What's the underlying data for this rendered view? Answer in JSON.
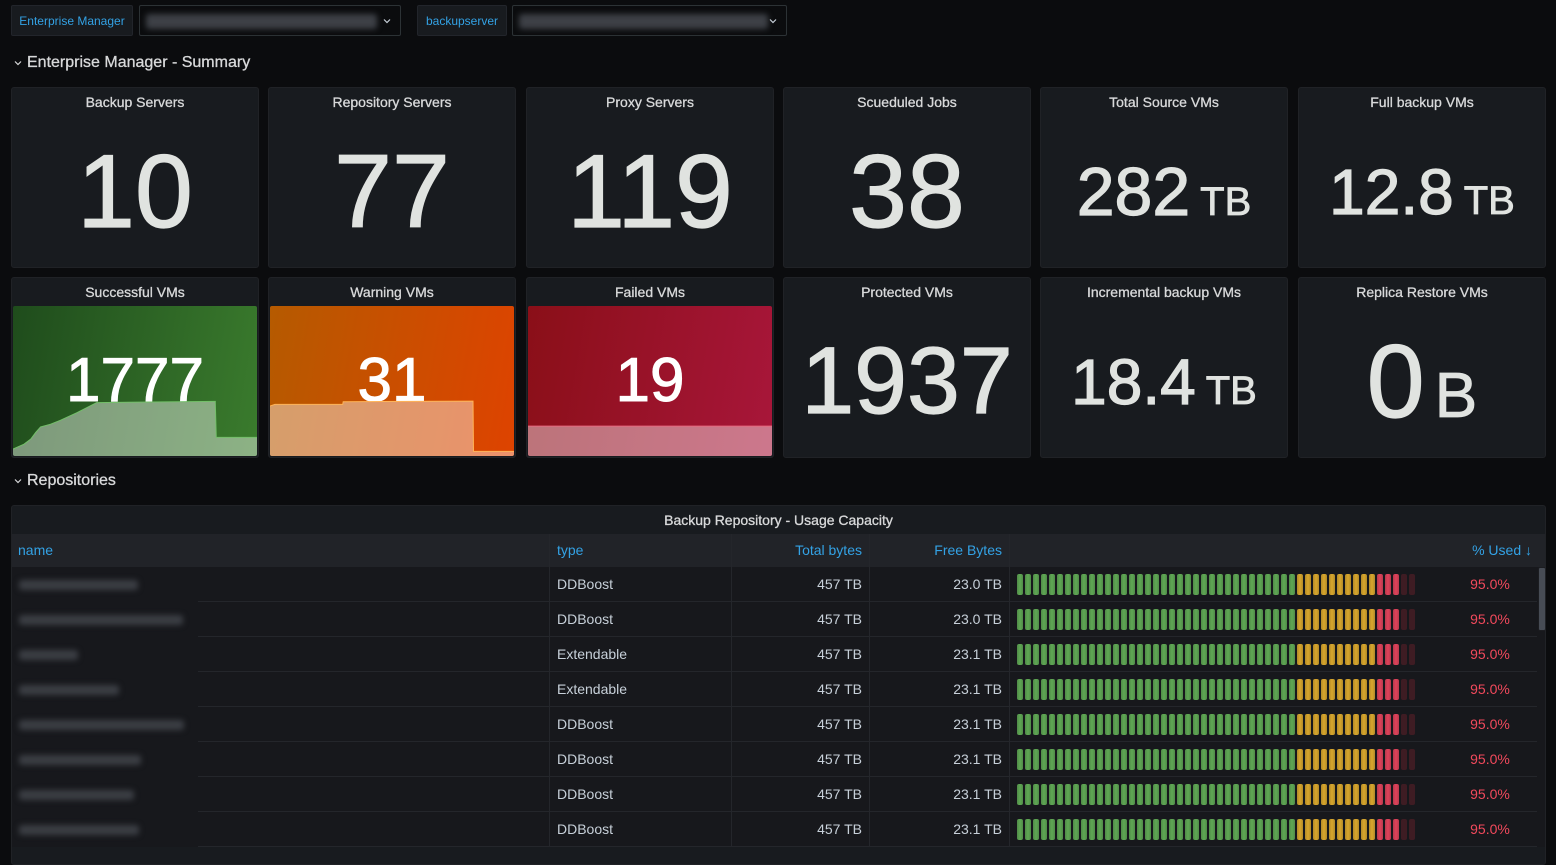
{
  "theme": {
    "page_bg": "#0b0c0e",
    "panel_bg": "#181b1f",
    "accent": "#33a2e5"
  },
  "variables": [
    {
      "label": "Enterprise Manager",
      "value": "",
      "value_redacted": true,
      "icon": "chevron-down-icon"
    },
    {
      "label": "backupserver",
      "value": "",
      "value_redacted": true,
      "icon": "chevron-down-icon"
    }
  ],
  "sections": {
    "summary": {
      "title": "Enterprise Manager - Summary",
      "expanded": true
    },
    "repositories": {
      "title": "Repositories",
      "expanded": true
    }
  },
  "stats": [
    {
      "title": "Backup Servers",
      "value": "10",
      "unit": ""
    },
    {
      "title": "Repository Servers",
      "value": "77",
      "unit": ""
    },
    {
      "title": "Proxy Servers",
      "value": "119",
      "unit": ""
    },
    {
      "title": "Scueduled Jobs",
      "value": "38",
      "unit": ""
    },
    {
      "title": "Total Source VMs",
      "value": "282",
      "unit": "TB"
    },
    {
      "title": "Full backup VMs",
      "value": "12.8",
      "unit": "TB"
    },
    {
      "title": "Successful VMs",
      "value": "1777",
      "unit": "",
      "color_mode": "background",
      "bg_gradient": [
        "#1f4c1c",
        "#3a7b2d"
      ],
      "line_color": "#73bf69",
      "sparkline": [
        [
          0,
          0.046
        ],
        [
          0.045,
          0.079
        ],
        [
          0.073,
          0.113
        ],
        [
          0.093,
          0.157
        ],
        [
          0.113,
          0.194
        ],
        [
          0.154,
          0.212
        ],
        [
          0.194,
          0.238
        ],
        [
          0.262,
          0.289
        ],
        [
          0.343,
          0.356
        ],
        [
          0.829,
          0.364
        ],
        [
          0.833,
          0.124
        ],
        [
          1,
          0.124
        ]
      ]
    },
    {
      "title": "Warning VMs",
      "value": "31",
      "unit": "",
      "color_mode": "background",
      "bg_gradient": [
        "#b55a00",
        "#de4300"
      ],
      "line_color": "#ffb357",
      "sparkline": [
        [
          0,
          0.333
        ],
        [
          0.02,
          0.344
        ],
        [
          0.298,
          0.344
        ],
        [
          0.3,
          0.362
        ],
        [
          0.832,
          0.366
        ],
        [
          0.834,
          0.031
        ],
        [
          1,
          0.031
        ]
      ]
    },
    {
      "title": "Failed VMs",
      "value": "19",
      "unit": "",
      "color_mode": "background",
      "bg_gradient": [
        "#8a0f18",
        "#a8163a"
      ],
      "line_color": "#e86a80",
      "sparkline": [
        [
          0,
          0.199
        ],
        [
          1,
          0.199
        ]
      ]
    },
    {
      "title": "Protected VMs",
      "value": "1937",
      "unit": ""
    },
    {
      "title": "Incremental backup VMs",
      "value": "18.4",
      "unit": "TB"
    },
    {
      "title": "Replica Restore VMs",
      "value": "0",
      "unit": "B"
    }
  ],
  "table": {
    "title": "Backup Repository - Usage Capacity",
    "columns": [
      {
        "key": "name",
        "label": "name"
      },
      {
        "key": "type",
        "label": "type"
      },
      {
        "key": "total",
        "label": "Total bytes"
      },
      {
        "key": "free",
        "label": "Free Bytes"
      },
      {
        "key": "used",
        "label": "% Used ↓",
        "sort": "desc",
        "sort_icon": "arrow-down-icon"
      }
    ],
    "gauge": {
      "min": 0,
      "max": 100,
      "thresholds": [
        {
          "from": 0,
          "color": "#5fa854"
        },
        {
          "from": 70,
          "color": "#d9a72c"
        },
        {
          "from": 90,
          "color": "#e0425a"
        }
      ],
      "empty_color": "#3e1c23",
      "value_color": "#f2495c"
    },
    "rows": [
      {
        "name": "",
        "name_redacted": true,
        "type": "DDBoost",
        "total": "457 TB",
        "free": "23.0 TB",
        "used": 95.0,
        "used_label": "95.0%"
      },
      {
        "name": "",
        "name_redacted": true,
        "type": "DDBoost",
        "total": "457 TB",
        "free": "23.0 TB",
        "used": 95.0,
        "used_label": "95.0%"
      },
      {
        "name": "",
        "name_redacted": true,
        "type": "Extendable",
        "total": "457 TB",
        "free": "23.1 TB",
        "used": 95.0,
        "used_label": "95.0%"
      },
      {
        "name": "",
        "name_redacted": true,
        "type": "Extendable",
        "total": "457 TB",
        "free": "23.1 TB",
        "used": 95.0,
        "used_label": "95.0%"
      },
      {
        "name": "",
        "name_redacted": true,
        "type": "DDBoost",
        "total": "457 TB",
        "free": "23.1 TB",
        "used": 95.0,
        "used_label": "95.0%"
      },
      {
        "name": "",
        "name_redacted": true,
        "type": "DDBoost",
        "total": "457 TB",
        "free": "23.1 TB",
        "used": 95.0,
        "used_label": "95.0%"
      },
      {
        "name": "",
        "name_redacted": true,
        "type": "DDBoost",
        "total": "457 TB",
        "free": "23.1 TB",
        "used": 95.0,
        "used_label": "95.0%"
      },
      {
        "name": "",
        "name_redacted": true,
        "type": "DDBoost",
        "total": "457 TB",
        "free": "23.1 TB",
        "used": 95.0,
        "used_label": "95.0%"
      }
    ]
  }
}
